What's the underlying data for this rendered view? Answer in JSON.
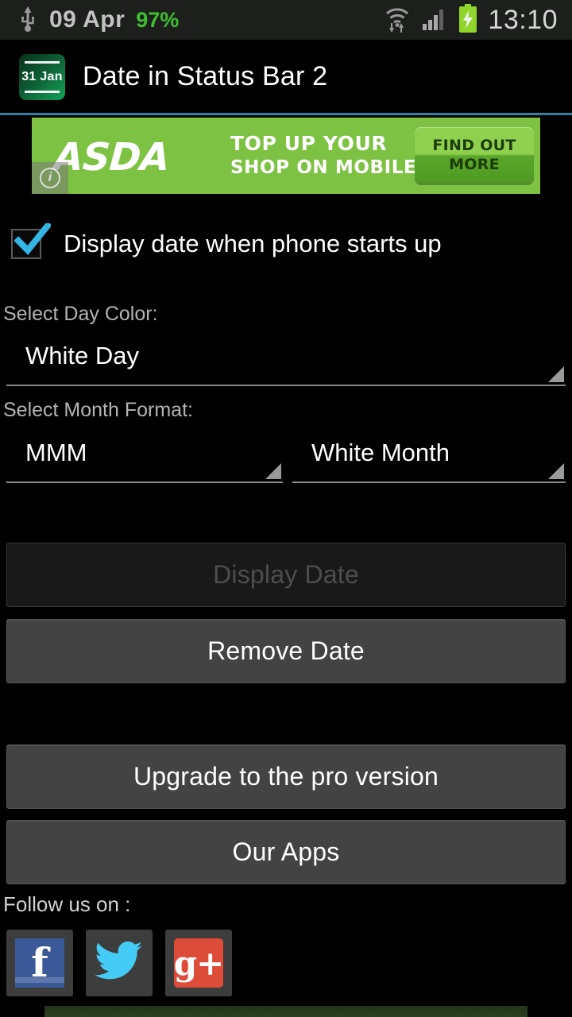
{
  "status_bar": {
    "usb_icon": "usb-icon",
    "date": "09 Apr",
    "battery_percent": "97%",
    "battery_percent_color": "#3fbf2f",
    "wifi_icon": "wifi-icon",
    "signal_icon": "cellular-signal-icon",
    "battery_icon": "battery-charging-icon",
    "clock": "13:10"
  },
  "title_bar": {
    "app_icon_label": "31 Jan",
    "app_icon_name": "calendar-app-icon",
    "title": "Date in Status Bar 2",
    "divider_color": "#2c7fa8"
  },
  "ad": {
    "brand": "ASDA",
    "line1": "TOP UP YOUR",
    "line2": "SHOP ON MOBILE",
    "cta_line1": "FIND OUT",
    "cta_line2": "MORE",
    "info_glyph": "i",
    "background_color": "#7dc242"
  },
  "settings": {
    "startup_checkbox": {
      "label": "Display date when phone starts up",
      "checked": true,
      "check_color": "#33b5e5"
    },
    "day_color": {
      "label": "Select Day Color:",
      "selected": "White Day"
    },
    "month_format": {
      "label": "Select Month Format:",
      "format_selected": "MMM",
      "color_selected": "White Month"
    }
  },
  "actions": {
    "display_date": {
      "label": "Display Date",
      "enabled": false
    },
    "remove_date": {
      "label": "Remove Date",
      "enabled": true
    },
    "upgrade": {
      "label": "Upgrade to the pro version",
      "enabled": true
    },
    "our_apps": {
      "label": "Our Apps",
      "enabled": true
    }
  },
  "follow": {
    "label": "Follow us on :",
    "facebook": {
      "name": "facebook-icon",
      "glyph": "f",
      "color": "#3b5998"
    },
    "twitter": {
      "name": "twitter-icon",
      "color": "#44ccf6"
    },
    "googleplus": {
      "name": "google-plus-icon",
      "glyph": "g+",
      "color": "#dd4b39"
    }
  }
}
